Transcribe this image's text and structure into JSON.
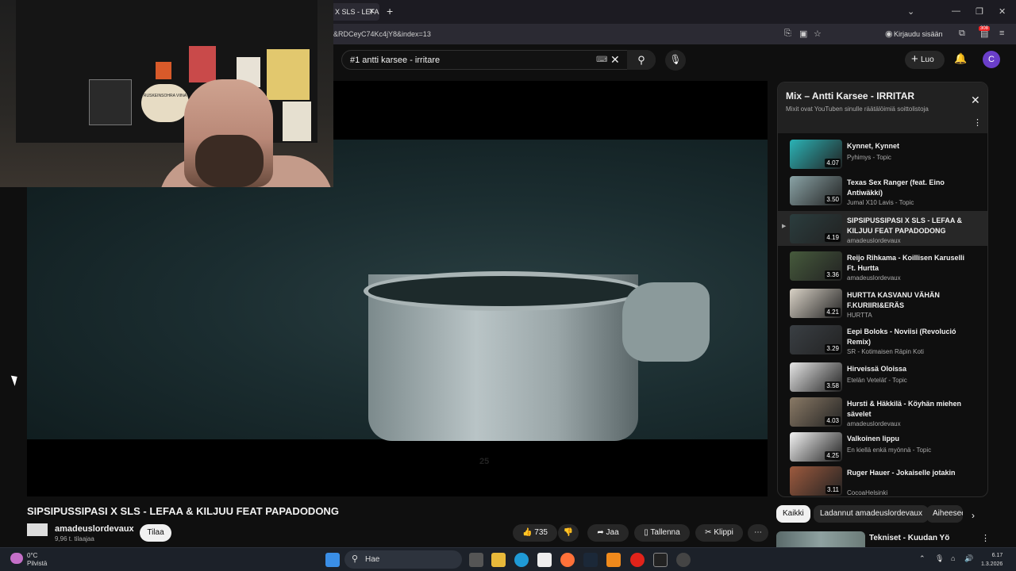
{
  "browser": {
    "tab_label": "X SLS - LEFA",
    "url": "&RDCeyC74Kc4jY8&index=13",
    "sign_in": "Kirjaudu sisään",
    "notif_count": "308"
  },
  "youtube": {
    "search_value": "#1 antti karsee - irritare",
    "create_label": "Luo",
    "avatar_letter": "C"
  },
  "video": {
    "title": "SIPSIPUSSIPASI X SLS - LEFAA & KILJUU FEAT PAPADODONG",
    "bucket_mark": "25",
    "channel_name": "amadeuslordevaux",
    "subscribers": "9,96 t. tilaajaa",
    "subscribe_label": "Tilaa",
    "likes": "735",
    "share_label": "Jaa",
    "save_label": "Tallenna",
    "clip_label": "Klippi"
  },
  "webcam": {
    "seal_text": "RUSKEINSOHRA VIINA"
  },
  "playlist": {
    "title": "Mix – Antti Karsee - IRRITAR",
    "subtitle": "Mixit ovat YouTuben sinulle räätälöimiä soittolistoja",
    "items": [
      {
        "title": "Kynnet, Kynnet",
        "channel": "Pyhimys - Topic",
        "duration": "4.07",
        "color": "#2bb3b6"
      },
      {
        "title": "Texas Sex Ranger (feat. Eino Antiwäkki)",
        "channel": "Jumal X10 Lavis - Topic",
        "duration": "3.50",
        "color": "#8aa3a6"
      },
      {
        "title": "SIPSIPUSSIPASI X SLS - LEFAA & KILJUU FEAT PAPADODONG",
        "channel": "amadeuslordevaux",
        "duration": "4.19",
        "color": "#2b3d3e"
      },
      {
        "title": "Reijo Rihkama - Koillisen Karuselli Ft. Hurtta",
        "channel": "amadeuslordevaux",
        "duration": "3.36",
        "color": "#465a3c"
      },
      {
        "title": "HURTTA KASVANU VÄHÄN F.KURIIRI&ERÄS",
        "channel": "HURTTA",
        "duration": "4.21",
        "color": "#d9d2c6"
      },
      {
        "title": "Eepi Boloks - Noviisi (Revolució Remix)",
        "channel": "SR - Kotimaisen Räpin Koti",
        "duration": "3.29",
        "color": "#3a3f44"
      },
      {
        "title": "Hirveissä Oloissa",
        "channel": "Etelän Veteläť - Topic",
        "duration": "3.58",
        "color": "#e5e5e5"
      },
      {
        "title": "Hursti & Häkkilä - Köyhän miehen sävelet",
        "channel": "amadeuslordevaux",
        "duration": "4.03",
        "color": "#8a7a66"
      },
      {
        "title": "Valkoinen lippu",
        "channel": "En kiellä enkä myönnä - Topic",
        "duration": "4.25",
        "color": "#f2f2f2"
      },
      {
        "title": "Ruger Hauer - Jokaiselle jotakin",
        "channel": "CocoaHelsinki",
        "duration": "3.11",
        "color": "#9d5a3e"
      }
    ]
  },
  "chips": [
    "Kaikki",
    "Ladannut amadeuslordevaux",
    "Aiheeseen"
  ],
  "next_up": {
    "title": "Tekniset - Kuudan Yö"
  },
  "taskbar": {
    "temp": "0°C",
    "weather": "Pilvistä",
    "search_label": "Hae",
    "time": "6.17",
    "date": "1.3.2026"
  }
}
